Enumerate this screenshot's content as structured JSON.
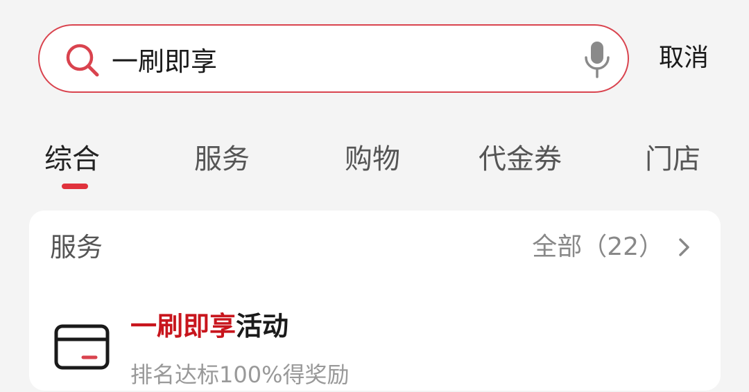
{
  "search": {
    "query": "一刷即享",
    "cancel_label": "取消"
  },
  "tabs": [
    {
      "label": "综合",
      "active": true
    },
    {
      "label": "服务",
      "active": false
    },
    {
      "label": "购物",
      "active": false
    },
    {
      "label": "代金券",
      "active": false
    },
    {
      "label": "门店",
      "active": false
    }
  ],
  "services_section": {
    "title": "服务",
    "view_all_label": "全部（22）",
    "items": [
      {
        "title_highlight": "一刷即享",
        "title_rest": "活动",
        "subtitle": "排名达标100%得奖励",
        "icon": "card-icon"
      }
    ]
  },
  "colors": {
    "accent": "#d9434e",
    "highlight_text": "#c8151d",
    "background": "#f4f4f4"
  }
}
